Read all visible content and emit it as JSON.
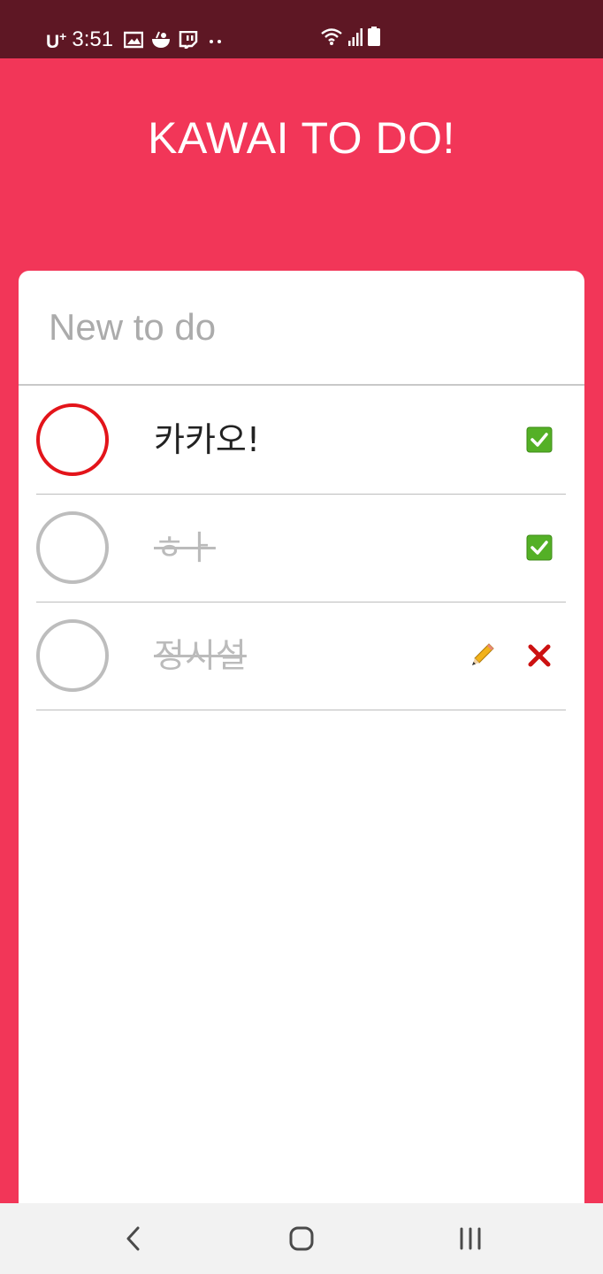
{
  "status_bar": {
    "carrier": "U",
    "carrier_sup": "+",
    "time": "3:51",
    "icons": [
      "gallery-icon",
      "bowl-icon",
      "twitch-icon",
      "more-dots-icon",
      "wifi-icon",
      "signal-icon",
      "battery-icon"
    ]
  },
  "header": {
    "title": "KAWAI TO DO!"
  },
  "new_todo": {
    "placeholder": "New to do",
    "value": ""
  },
  "todos": [
    {
      "text": "카카오!",
      "done": false,
      "actions": [
        "check-icon"
      ]
    },
    {
      "text": "ㅎㅏ",
      "done": true,
      "actions": [
        "check-icon"
      ]
    },
    {
      "text": "정시설",
      "done": true,
      "actions": [
        "pencil-icon",
        "delete-x-icon"
      ]
    }
  ],
  "colors": {
    "background": "#f23658",
    "status_bar": "#5e1724",
    "active_circle": "#e3141a",
    "inactive_circle": "#bdbdbd",
    "check_green": "#54b026",
    "delete_red": "#cc1111"
  },
  "nav_bar": {
    "icons": [
      "back-icon",
      "home-icon",
      "recents-icon"
    ]
  }
}
